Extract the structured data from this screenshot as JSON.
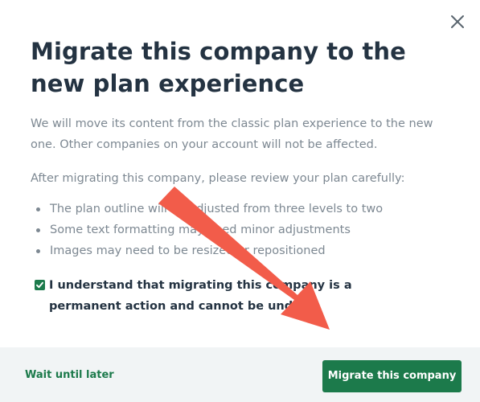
{
  "dialog": {
    "title": "Migrate this company to the new plan experience",
    "intro": "We will move its content from the classic plan experience to the new one. Other companies on your account will not be affected.",
    "review_note": "After migrating this company, please review your plan carefully:",
    "bullets": [
      "The plan outline will be adjusted from three levels to two",
      "Some text formatting may need minor adjustments",
      "Images may need to be resized or repositioned"
    ],
    "confirm_label": "I understand that migrating this company is a permanent action and cannot be undone",
    "confirm_checked": true,
    "close_icon": "close-icon"
  },
  "footer": {
    "secondary_label": "Wait until later",
    "primary_label": "Migrate this company"
  },
  "colors": {
    "accent": "#1c7a4b",
    "title": "#243342",
    "body_text": "#7d8892",
    "footer_bg": "#f1f4f5",
    "annotation_arrow": "#f25c4a"
  }
}
